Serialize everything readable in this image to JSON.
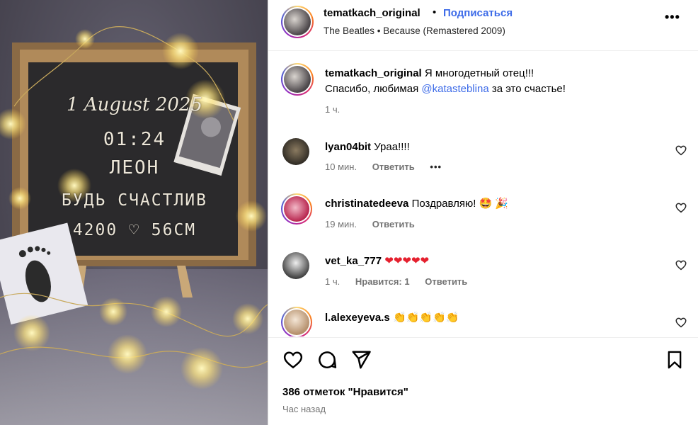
{
  "post": {
    "author": "tematkach_original",
    "follow_label": "Подписаться",
    "separator": "•",
    "music": "The Beatles • Because (Remastered 2009)",
    "more_icon": "more-horizontal-icon"
  },
  "image": {
    "board_lines": [
      "1 August 2025",
      "01:24",
      "ЛЕОН",
      "БУДЬ СЧАСТЛИВ",
      "4200 ♡ 56CM"
    ]
  },
  "caption": {
    "author": "tematkach_original",
    "text_before": "Я многодетный отец!!!",
    "line2_before": "Спасибо, любимая ",
    "mention": "@katasteblina",
    "line2_after": " за это счастье!",
    "time": "1 ч."
  },
  "comments": [
    {
      "user": "lyan04bit",
      "text": "Ураа!!!!",
      "time": "10 мин.",
      "reply": "Ответить",
      "more": "•••",
      "likes": ""
    },
    {
      "user": "christinatedeeva",
      "text": "Поздравляю! 🤩 🎉",
      "time": "19 мин.",
      "reply": "Ответить",
      "likes": ""
    },
    {
      "user": "vet_ka_777",
      "text": "❤❤❤❤❤",
      "time": "1 ч.",
      "likes": "Нравится: 1",
      "reply": "Ответить"
    },
    {
      "user": "l.alexeyeva.s",
      "text": "👏👏👏👏👏",
      "time": "",
      "likes": "",
      "reply": ""
    }
  ],
  "footer": {
    "likes_text": "386 отметок \"Нравится\"",
    "posted": "Час назад"
  },
  "colors": {
    "link": "#3d6be8",
    "muted": "#737373",
    "heart": "#e5202e"
  }
}
